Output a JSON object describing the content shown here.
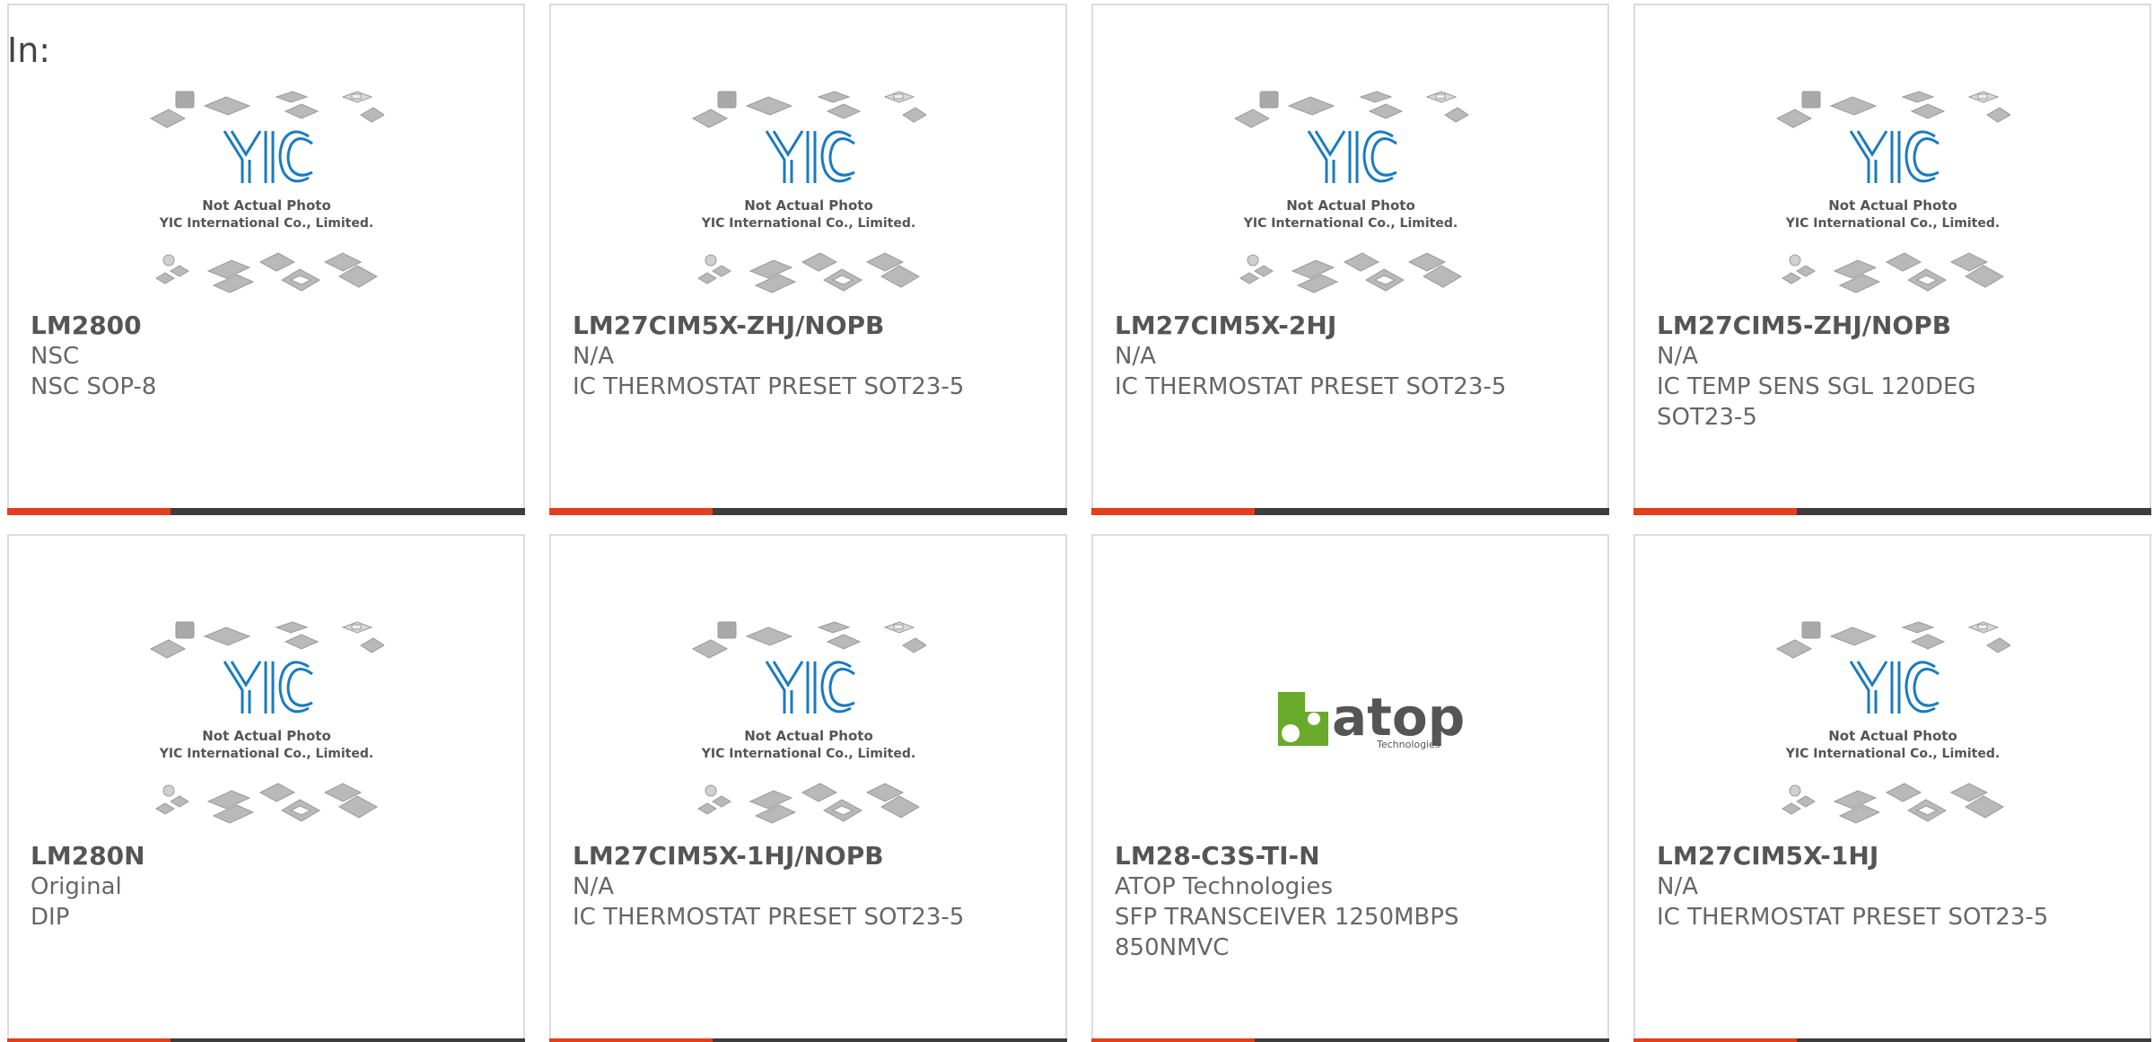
{
  "filter_label": "In:",
  "photo_caption": {
    "line1": "Not Actual Photo",
    "line2": "YIC International Co., Limited.",
    "brand": "YIC"
  },
  "atop_logo": {
    "brand": "atop",
    "tagline": "Technologies"
  },
  "colors": {
    "accent": "#e0401c",
    "bar": "#3d3d3d",
    "yic_blue": "#1a7bbf",
    "atop_green": "#6aaa2a"
  },
  "products": [
    {
      "part": "LM2800",
      "maker": "NSC",
      "desc": "NSC SOP-8",
      "image": "yic-placeholder"
    },
    {
      "part": "LM27CIM5X-ZHJ/NOPB",
      "maker": "N/A",
      "desc": "IC THERMOSTAT PRESET SOT23-5",
      "image": "yic-placeholder"
    },
    {
      "part": "LM27CIM5X-2HJ",
      "maker": "N/A",
      "desc": "IC THERMOSTAT PRESET SOT23-5",
      "image": "yic-placeholder"
    },
    {
      "part": "LM27CIM5-ZHJ/NOPB",
      "maker": "N/A",
      "desc": "IC TEMP SENS SGL 120DEG SOT23-5",
      "image": "yic-placeholder"
    },
    {
      "part": "LM280N",
      "maker": "Original",
      "desc": "DIP",
      "image": "yic-placeholder"
    },
    {
      "part": "LM27CIM5X-1HJ/NOPB",
      "maker": "N/A",
      "desc": "IC THERMOSTAT PRESET SOT23-5",
      "image": "yic-placeholder"
    },
    {
      "part": "LM28-C3S-TI-N",
      "maker": "ATOP Technologies",
      "desc": "SFP TRANSCEIVER 1250MBPS 850NMVC",
      "image": "atop-logo"
    },
    {
      "part": "LM27CIM5X-1HJ",
      "maker": "N/A",
      "desc": "IC THERMOSTAT PRESET SOT23-5",
      "image": "yic-placeholder"
    }
  ]
}
